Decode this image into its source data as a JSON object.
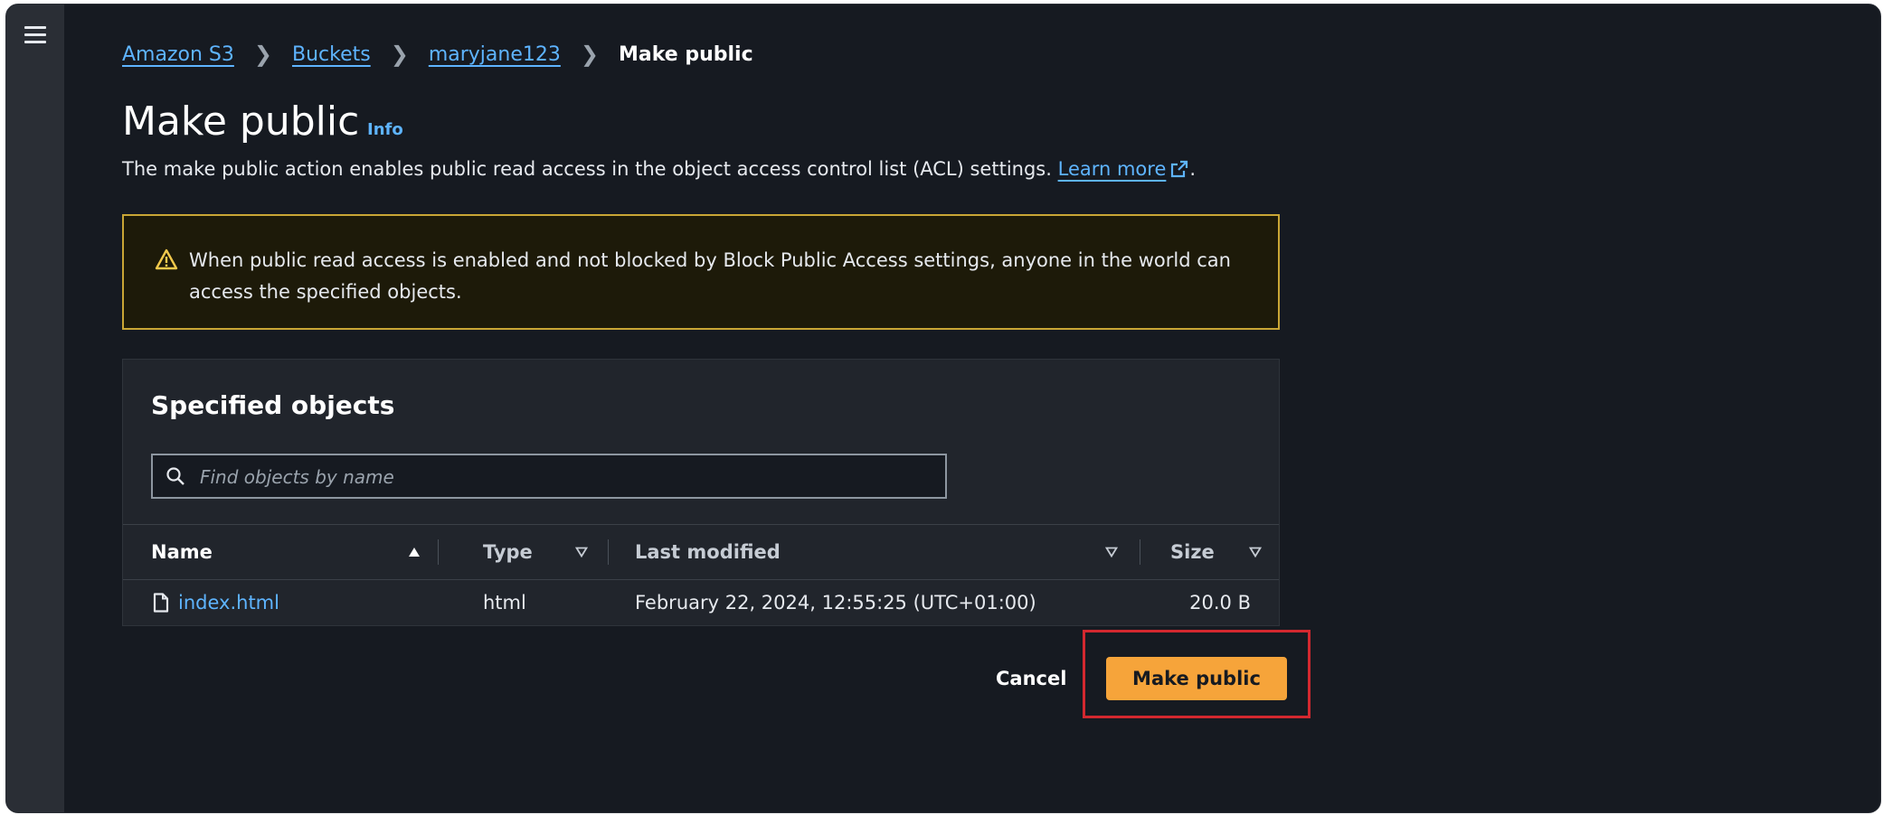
{
  "breadcrumb": {
    "items": [
      "Amazon S3",
      "Buckets",
      "maryjane123"
    ],
    "current": "Make public"
  },
  "page": {
    "title": "Make public",
    "info_label": "Info",
    "description": "The make public action enables public read access in the object access control list (ACL) settings.",
    "learn_more": "Learn more",
    "description_end": "."
  },
  "alert": {
    "text": "When public read access is enabled and not blocked by Block Public Access settings, anyone in the world can access the specified objects."
  },
  "objects_panel": {
    "title": "Specified objects",
    "search_placeholder": "Find objects by name",
    "columns": [
      "Name",
      "Type",
      "Last modified",
      "Size"
    ],
    "rows": [
      {
        "name": "index.html",
        "type": "html",
        "last_modified": "February 22, 2024, 12:55:25 (UTC+01:00)",
        "size": "20.0 B"
      }
    ]
  },
  "actions": {
    "cancel": "Cancel",
    "submit": "Make public"
  },
  "colors": {
    "background": "#161a21",
    "link": "#5eb4ff",
    "primary_button": "#f6a43a",
    "warning_border": "#c9a635",
    "highlight_box": "#d3282f"
  },
  "icons": [
    "menu-icon",
    "chevron-right-icon",
    "external-link-icon",
    "warning-icon",
    "search-icon",
    "sort-ascending-icon",
    "sort-descending-icon",
    "file-icon"
  ]
}
